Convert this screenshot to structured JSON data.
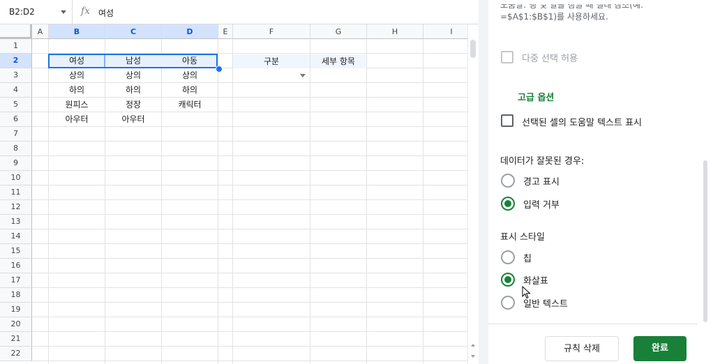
{
  "formula_bar": {
    "name_box": "B2:D2",
    "fx_label": "fx",
    "value": "여성"
  },
  "grid": {
    "columns": [
      "A",
      "B",
      "C",
      "D",
      "E",
      "F",
      "G",
      "H",
      "I"
    ],
    "selected_columns": [
      "B",
      "C",
      "D"
    ],
    "rows": [
      "1",
      "2",
      "3",
      "4",
      "5",
      "6",
      "7",
      "8",
      "9",
      "10",
      "11",
      "12",
      "13",
      "14",
      "15",
      "16",
      "17",
      "18",
      "19",
      "20",
      "21",
      "22"
    ],
    "selected_rows": [
      "2"
    ],
    "cells": {
      "B2": "여성",
      "C2": "남성",
      "D2": "아동",
      "B3": "상의",
      "C3": "상의",
      "D3": "상의",
      "B4": "하의",
      "C4": "하의",
      "D4": "하의",
      "B5": "원피스",
      "C5": "정장",
      "D5": "캐릭터",
      "B6": "아우터",
      "C6": "아우터",
      "F2": "구분",
      "G2": "세부 항목"
    }
  },
  "panel": {
    "clipped_help_line1": "도움말: 행 및 열을 잠글 때 절대 참조(예:",
    "clipped_help_line2": "=$A$1:$B$1)를 사용하세요.",
    "multi_select_label": "다중 선택 허용",
    "advanced_options": "고급 옵션",
    "show_help_label": "선택된 셀의 도움말 텍스트 표시",
    "invalid_heading": "데이터가 잘못된 경우:",
    "invalid_options": [
      "경고 표시",
      "입력 거부"
    ],
    "invalid_selected": "입력 거부",
    "style_heading": "표시 스타일",
    "style_options": [
      "칩",
      "화살표",
      "일반 텍스트"
    ],
    "style_selected": "화살표",
    "remove_button": "규칙 삭제",
    "done_button": "완료"
  },
  "colors": {
    "accent": "#188038",
    "selection": "#1a73e8",
    "header_selected": "#d3e3fd"
  }
}
